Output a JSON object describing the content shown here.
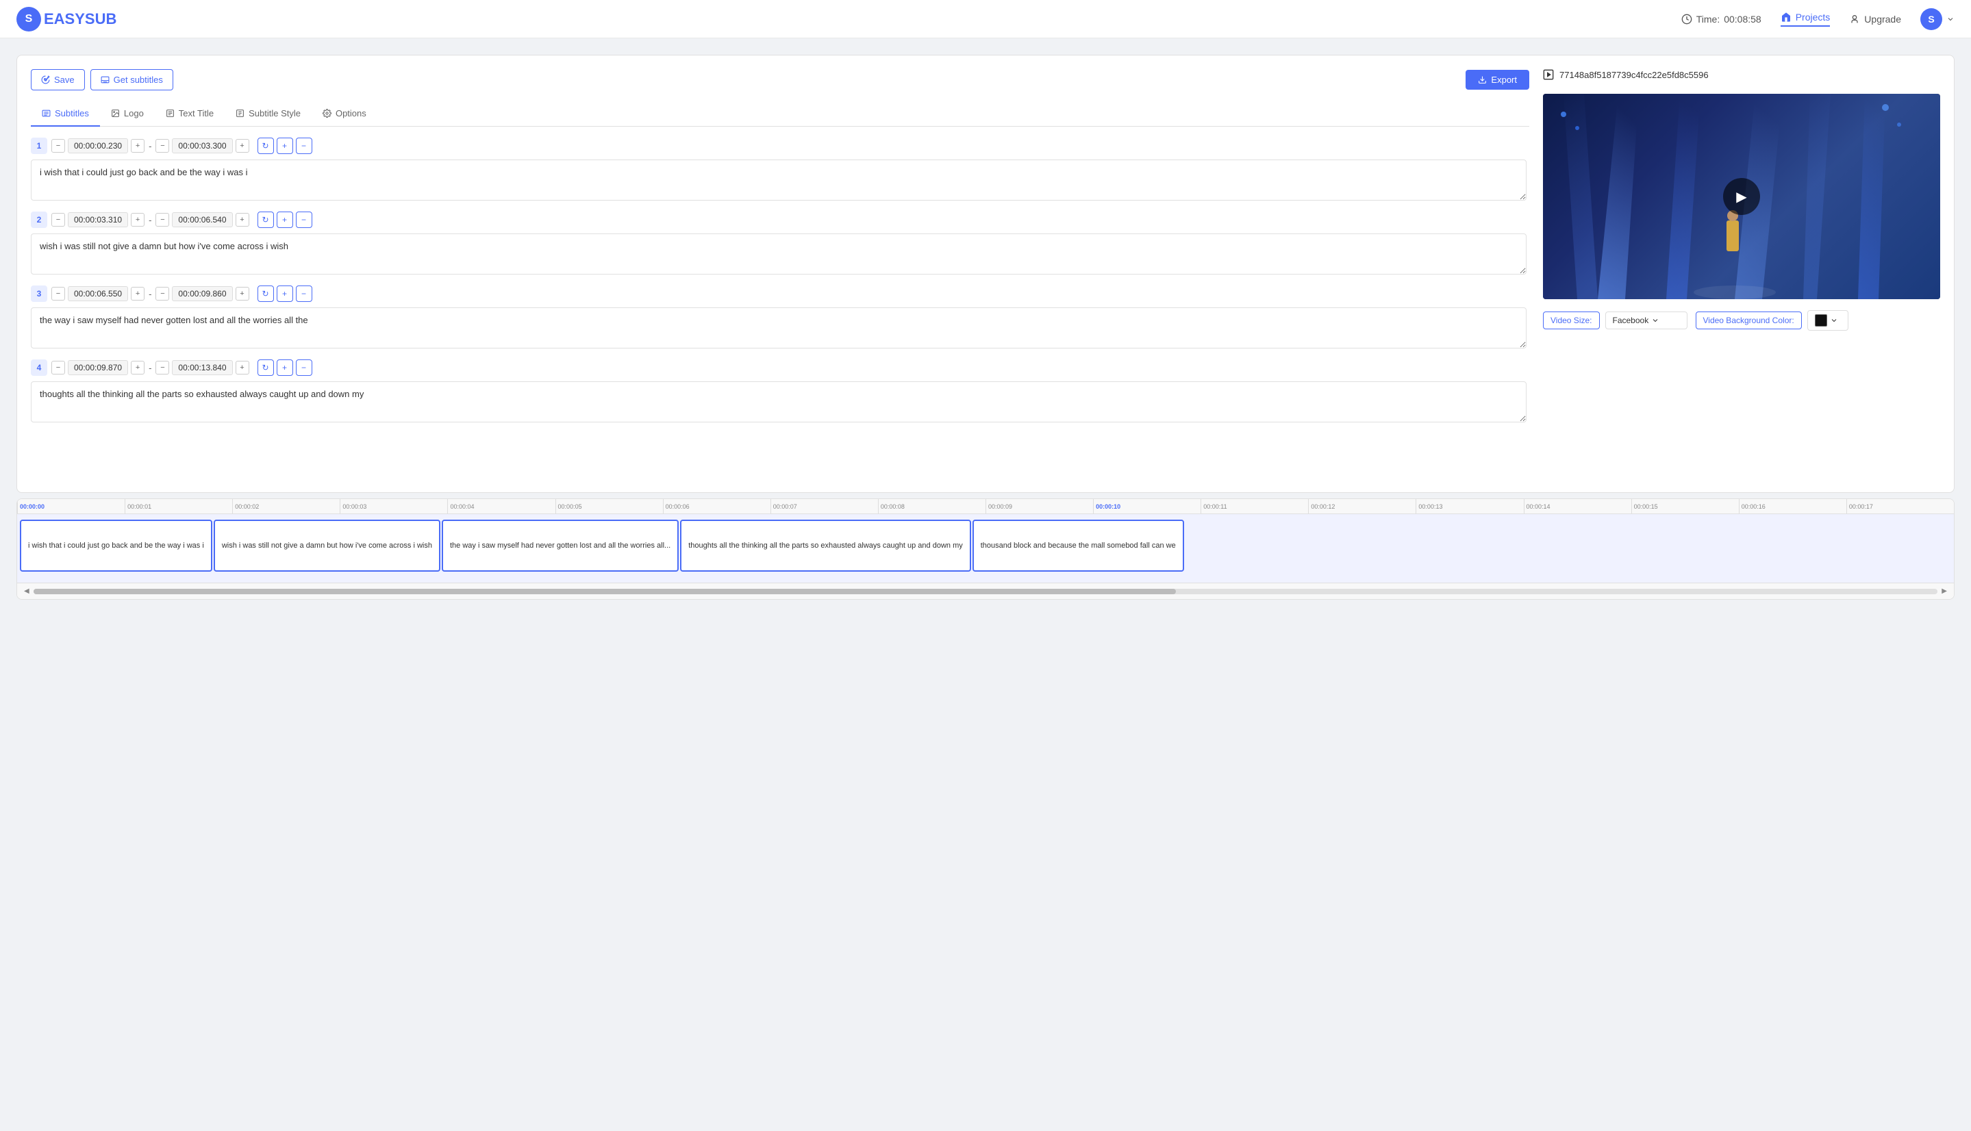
{
  "header": {
    "logo_text": "EASY",
    "logo_letter": "S",
    "logo_suffix": "UB",
    "time_label": "Time:",
    "time_value": "00:08:58",
    "projects_label": "Projects",
    "upgrade_label": "Upgrade",
    "avatar_letter": "S"
  },
  "toolbar": {
    "save_label": "Save",
    "get_subtitles_label": "Get subtitles",
    "export_label": "Export"
  },
  "tabs": [
    {
      "id": "subtitles",
      "label": "Subtitles",
      "active": true,
      "icon": "list"
    },
    {
      "id": "logo",
      "label": "Logo",
      "active": false,
      "icon": "image"
    },
    {
      "id": "text-title",
      "label": "Text Title",
      "active": false,
      "icon": "text"
    },
    {
      "id": "subtitle-style",
      "label": "Subtitle Style",
      "active": false,
      "icon": "text-box"
    },
    {
      "id": "options",
      "label": "Options",
      "active": false,
      "icon": "gear"
    }
  ],
  "subtitles": [
    {
      "num": "1",
      "start": "00:00:00.230",
      "end": "00:00:03.300",
      "text": "i wish that i could just go back and be the way i was i"
    },
    {
      "num": "2",
      "start": "00:00:03.310",
      "end": "00:00:06.540",
      "text": "wish i was still not give a damn but how i've come across i wish"
    },
    {
      "num": "3",
      "start": "00:00:06.550",
      "end": "00:00:09.860",
      "text": "the way i saw myself had never gotten lost and all the worries all the"
    },
    {
      "num": "4",
      "start": "00:00:09.870",
      "end": "00:00:13.840",
      "text": "thoughts all the thinking all the parts so exhausted always caught up and down my"
    }
  ],
  "video": {
    "id": "77148a8f5187739c4fcc22e5fd8c5596",
    "size_label": "Video Size:",
    "size_value": "Facebook",
    "bg_color_label": "Video Background Color:"
  },
  "timeline": {
    "ruler_marks": [
      "00:00:00",
      "00:00:01",
      "00:00:02",
      "00:00:03",
      "00:00:04",
      "00:00:05",
      "00:00:06",
      "00:00:07",
      "00:00:08",
      "00:00:09",
      "00:00:10",
      "00:00:11",
      "00:00:12",
      "00:00:13",
      "00:00:14",
      "00:00:15",
      "00:00:16",
      "00:00:17"
    ],
    "tracks": [
      {
        "text": "i wish that i could just go back and be the way i was i"
      },
      {
        "text": "wish i was still not give a damn but how i've come across i wish"
      },
      {
        "text": "the way i saw myself had never gotten lost and all the worries all..."
      },
      {
        "text": "thoughts all the thinking all the parts so exhausted always caught up and down my"
      },
      {
        "text": "thousand block and because the mall somebod fall can we"
      }
    ]
  }
}
